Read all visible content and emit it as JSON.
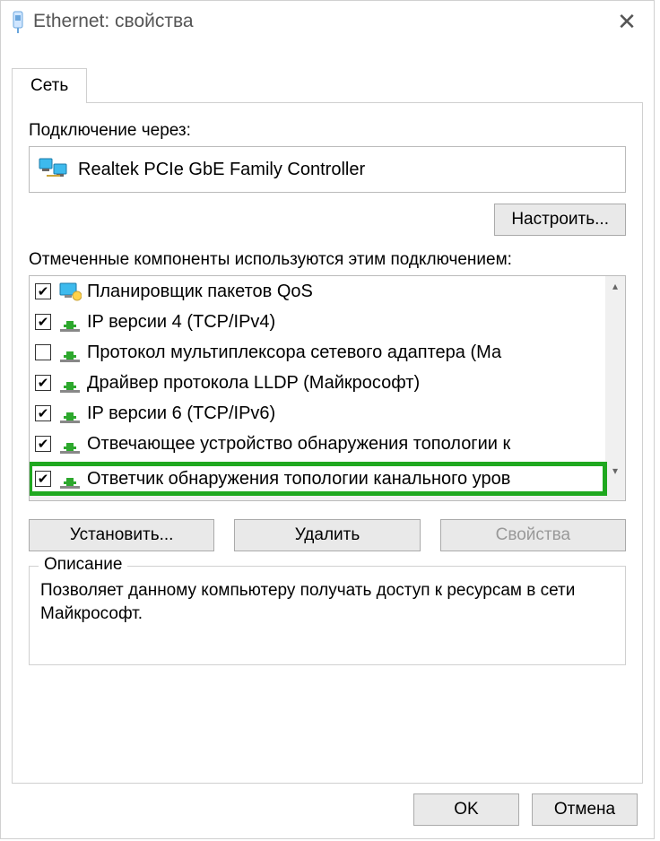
{
  "window": {
    "title": "Ethernet: свойства"
  },
  "tab": {
    "label": "Сеть"
  },
  "connection": {
    "label": "Подключение через:",
    "adapter": "Realtek PCIe GbE Family Controller",
    "configure_btn": "Настроить..."
  },
  "components": {
    "label": "Отмеченные компоненты используются этим подключением:",
    "items": [
      {
        "checked": true,
        "iconType": "monitor",
        "label": "Планировщик пакетов QoS"
      },
      {
        "checked": true,
        "iconType": "protocol",
        "label": "IP версии 4 (TCP/IPv4)"
      },
      {
        "checked": false,
        "iconType": "protocol",
        "label": "Протокол мультиплексора сетевого адаптера (Ма"
      },
      {
        "checked": true,
        "iconType": "protocol",
        "label": "Драйвер протокола LLDP (Майкрософт)"
      },
      {
        "checked": true,
        "iconType": "protocol",
        "label": "IP версии 6 (TCP/IPv6)"
      },
      {
        "checked": true,
        "iconType": "protocol",
        "label": "Отвечающее устройство обнаружения топологии к"
      },
      {
        "checked": true,
        "iconType": "protocol",
        "label": "Ответчик обнаружения топологии канального уров",
        "highlighted": true
      }
    ]
  },
  "actions": {
    "install": "Установить...",
    "remove": "Удалить",
    "properties": "Свойства"
  },
  "description": {
    "legend": "Описание",
    "text": "Позволяет данному компьютеру получать доступ к ресурсам в сети Майкрософт."
  },
  "footer": {
    "ok": "OK",
    "cancel": "Отмена"
  }
}
